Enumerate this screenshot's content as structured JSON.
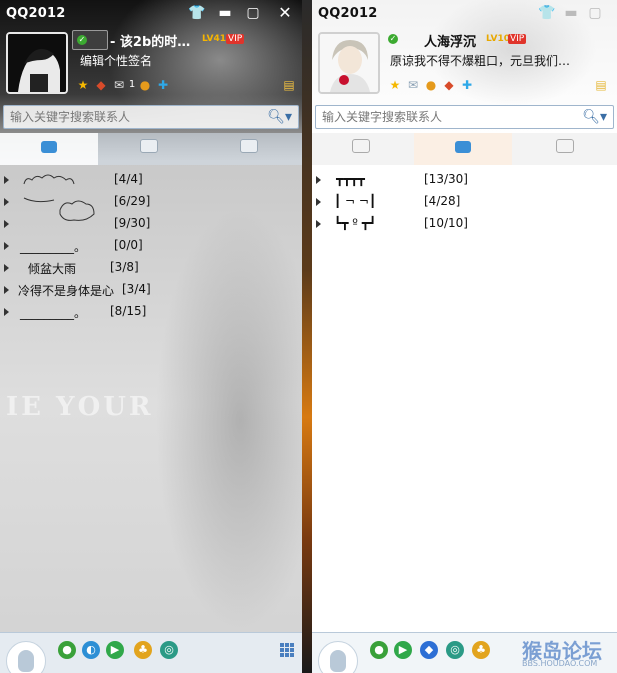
{
  "left": {
    "title": "QQ2012",
    "nickname": "- 该2b的时…",
    "level": "LV41",
    "vip": "VIP",
    "signature": "编辑个性签名",
    "mail_count": "1",
    "search_placeholder": "输入关键字搜索联系人",
    "watermark": "IE YOUR",
    "groups": [
      {
        "name": "",
        "count": "[4/4]"
      },
      {
        "name": "",
        "count": "[6/29]"
      },
      {
        "name": "",
        "count": "[9/30]"
      },
      {
        "name": "_________。",
        "count": "[0/0]"
      },
      {
        "name": "倾盆大雨",
        "count": "[3/8]"
      },
      {
        "name": "冷得不是身体是心",
        "count": "[3/4]"
      },
      {
        "name": "_________。",
        "count": "[8/15]"
      }
    ]
  },
  "right": {
    "title": "QQ2012",
    "nickname": "人海浮沉",
    "level": "LV10",
    "vip": "VIP",
    "signature": "原谅我不得不爆粗口，元旦我们…",
    "search_placeholder": "输入关键字搜索联系人",
    "groups": [
      {
        "name": "┳┳┳┳",
        "count": "[13/30]"
      },
      {
        "name": "┃ ¬  ¬┃",
        "count": "[4/28]"
      },
      {
        "name": "┗┳ º ┳┛",
        "count": "[10/10]"
      }
    ],
    "bbs_logo": "猴岛论坛",
    "bbs_url": "BBS.HOUDAO.COM"
  },
  "colors": {
    "status_online": "#3caa31",
    "vip_red": "#e0342b",
    "level_gold": "#f7b500",
    "accent_blue": "#3a6ea5"
  }
}
